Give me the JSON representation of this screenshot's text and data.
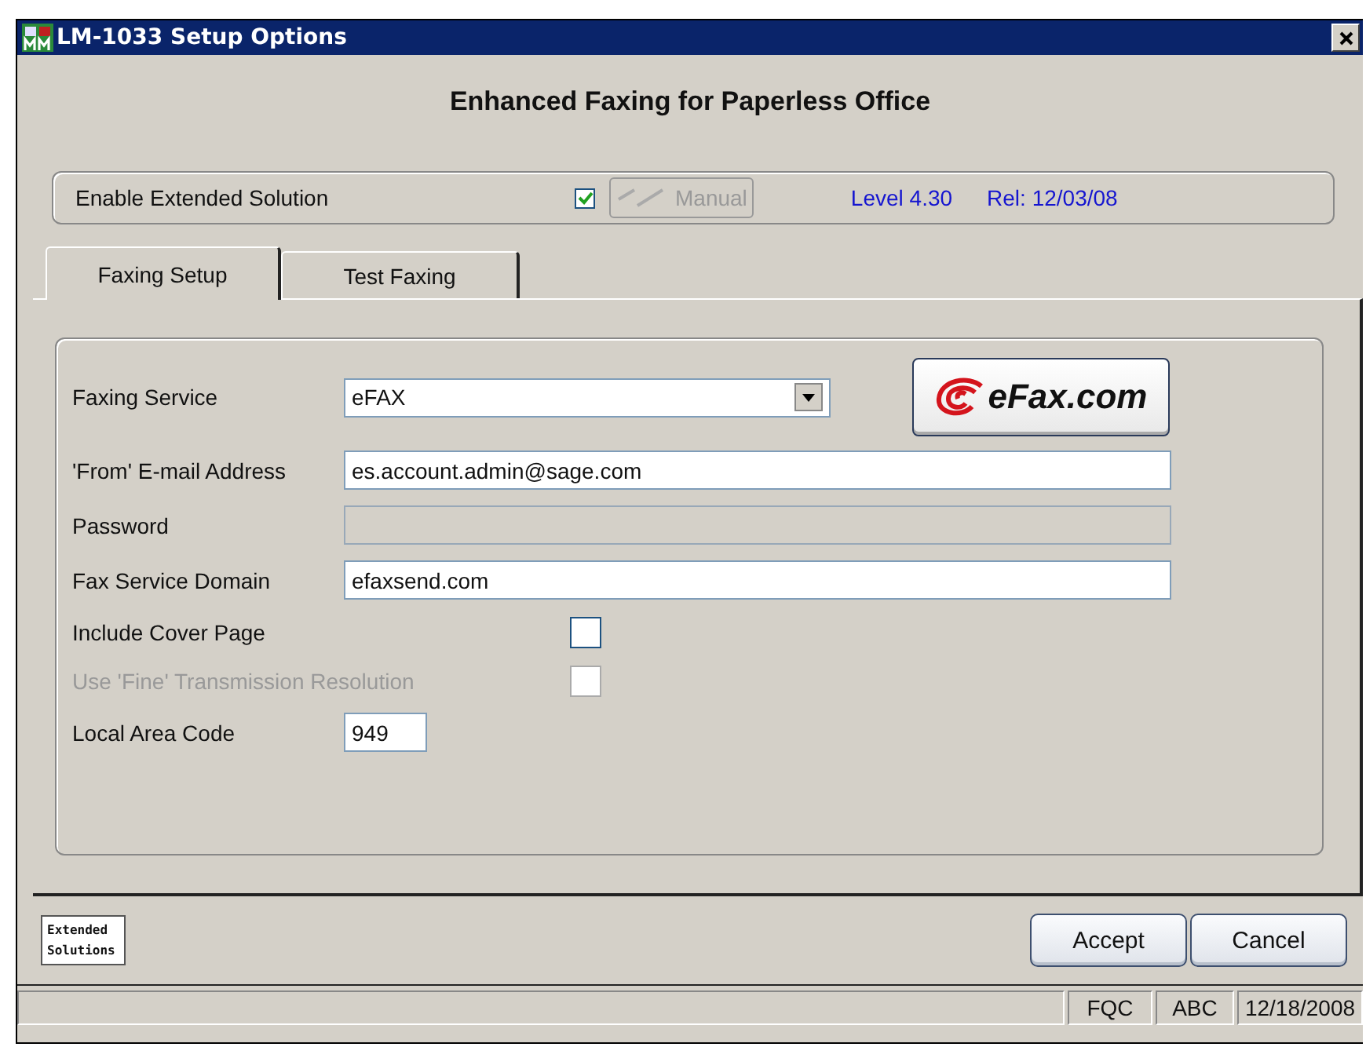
{
  "window": {
    "title": "LM-1033  Setup Options"
  },
  "heading": "Enhanced Faxing for Paperless Office",
  "enable": {
    "label": "Enable Extended Solution",
    "checked": true
  },
  "manual_button": {
    "label": "Manual",
    "disabled": true
  },
  "level": "Level 4.30",
  "release": "Rel: 12/03/08",
  "tabs": [
    {
      "label": "Faxing Setup",
      "selected": true
    },
    {
      "label": "Test Faxing",
      "selected": false
    }
  ],
  "service_logo": "eFax.com",
  "fields": [
    {
      "kind": "select",
      "label": "Faxing Service",
      "value": "eFAX",
      "disabled": false
    },
    {
      "kind": "text",
      "label": "'From' E-mail Address",
      "value": "es.account.admin@sage.com",
      "disabled": false
    },
    {
      "kind": "text",
      "label": "Password",
      "disabled": true
    },
    {
      "kind": "text",
      "label": "Fax Service Domain",
      "value": "efaxsend.com",
      "disabled": false
    },
    {
      "kind": "checkbox",
      "label": "Include Cover Page",
      "checked": false,
      "disabled": false
    },
    {
      "kind": "checkbox",
      "label": "Use 'Fine' Transmission Resolution",
      "checked": false,
      "disabled": true
    },
    {
      "kind": "short",
      "label": "Local Area Code",
      "value": "949",
      "disabled": false
    }
  ],
  "badge": "Extended Solutions",
  "buttons": [
    "Accept",
    "Cancel"
  ],
  "status_bar": [
    "FQC",
    "ABC",
    "12/18/2008"
  ]
}
